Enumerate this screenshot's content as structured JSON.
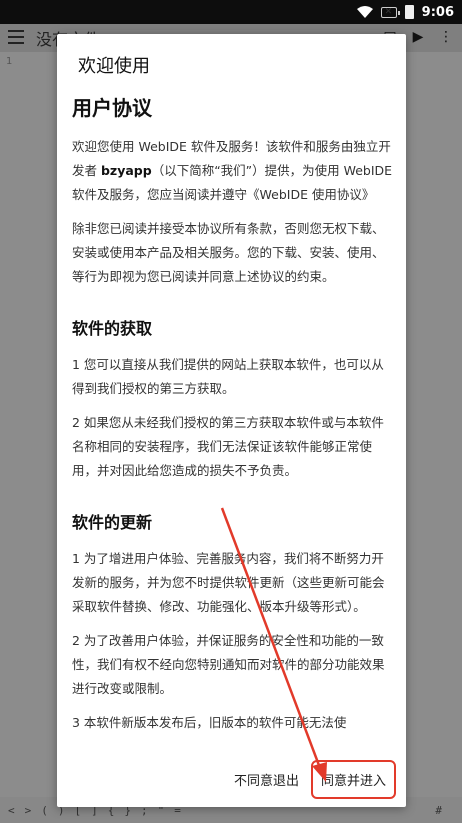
{
  "statusbar": {
    "time": "9:06"
  },
  "appbar": {
    "title": "没有文件"
  },
  "editor": {
    "gutter": "1"
  },
  "symbols": [
    "<",
    ">",
    "(",
    ")",
    "[",
    "]",
    "{",
    "}",
    ";",
    "\"",
    "="
  ],
  "symbols_right": "#",
  "dialog": {
    "title": "欢迎使用",
    "heading": "用户协议",
    "intro_part1": "欢迎您使用 WebIDE 软件及服务！该软件和服务由独立开发者 ",
    "intro_dev": "bzyapp",
    "intro_part2": "（以下简称“我们”）提供，为使用 WebIDE 软件及服务，您应当阅读并遵守《WebIDE 使用协议》",
    "para2": "除非您已阅读并接受本协议所有条款，否则您无权下载、安装或使用本产品及相关服务。您的下载、安装、使用、等行为即视为您已阅读并同意上述协议的约束。",
    "section1_title": "软件的获取",
    "section1_p1": "1 您可以直接从我们提供的网站上获取本软件，也可以从得到我们授权的第三方获取。",
    "section1_p2": "2 如果您从未经我们授权的第三方获取本软件或与本软件名称相同的安装程序，我们无法保证该软件能够正常使用，并对因此给您造成的损失不予负责。",
    "section2_title": "软件的更新",
    "section2_p1": "1 为了增进用户体验、完善服务内容，我们将不断努力开发新的服务，并为您不时提供软件更新（这些更新可能会采取软件替换、修改、功能强化、版本升级等形式）。",
    "section2_p2": "2 为了改善用户体验，并保证服务的安全性和功能的一致性，我们有权不经向您特别通知而对软件的部分功能效果进行改变或限制。",
    "section2_p3": "3 本软件新版本发布后，旧版本的软件可能无法使",
    "decline_label": "不同意退出",
    "agree_label": "同意并进入"
  },
  "colors": {
    "highlight": "#e23a2a",
    "scrim": "#8c8c8c"
  }
}
